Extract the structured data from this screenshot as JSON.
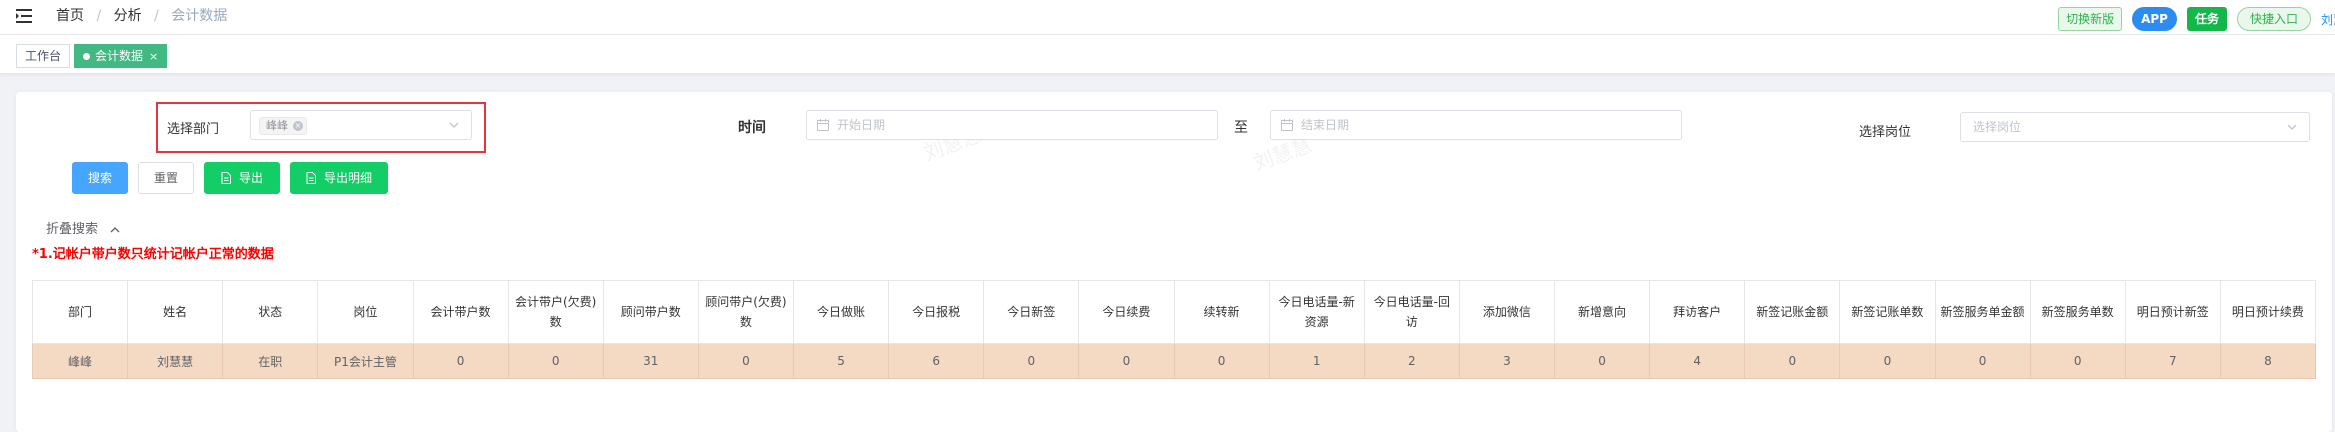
{
  "header": {
    "breadcrumb": [
      "首页",
      "分析",
      "会计数据"
    ],
    "separator": "/",
    "buttons": {
      "switch_label": "切换新版",
      "app_label": "APP",
      "task_label": "任务",
      "quick_label": "快捷入口"
    },
    "user_name": "刘慧"
  },
  "tags": [
    {
      "label": "工作台",
      "active": false
    },
    {
      "label": "会计数据",
      "active": true,
      "close": "×"
    }
  ],
  "search": {
    "dept_label": "选择部门",
    "dept_selected": "峰峰",
    "time_label": "时间",
    "start_placeholder": "开始日期",
    "to_label": "至",
    "end_placeholder": "结束日期",
    "position_label": "选择岗位",
    "position_placeholder": "选择岗位",
    "search_button": "搜索",
    "reset_button": "重置",
    "export_button": "导出",
    "export_detail_button": "导出明细",
    "fold_label": "折叠搜索"
  },
  "notice": "*1.记帐户带户数只统计记帐户正常的数据",
  "watermark": "刘慧慧",
  "table": {
    "columns": [
      "部门",
      "姓名",
      "状态",
      "岗位",
      "会计带户数",
      "会计带户(欠费)数",
      "顾问带户数",
      "顾问带户(欠费)数",
      "今日做账",
      "今日报税",
      "今日新签",
      "今日续费",
      "续转新",
      "今日电话量-新资源",
      "今日电话量-回访",
      "添加微信",
      "新增意向",
      "拜访客户",
      "新签记账金额",
      "新签记账单数",
      "新签服务单金额",
      "新签服务单数",
      "明日预计新签",
      "明日预计续费"
    ],
    "rows": [
      [
        "峰峰",
        "刘慧慧",
        "在职",
        "P1会计主管",
        "0",
        "0",
        "31",
        "0",
        "5",
        "6",
        "0",
        "0",
        "0",
        "1",
        "2",
        "3",
        "0",
        "4",
        "0",
        "0",
        "0",
        "0",
        "7",
        "8"
      ]
    ]
  },
  "colors": {
    "accent": "#46a6ff",
    "green": "#13ce66",
    "tag_active": "#42b983",
    "row_highlight": "#f4d9c3",
    "notice": "#ff0000"
  }
}
